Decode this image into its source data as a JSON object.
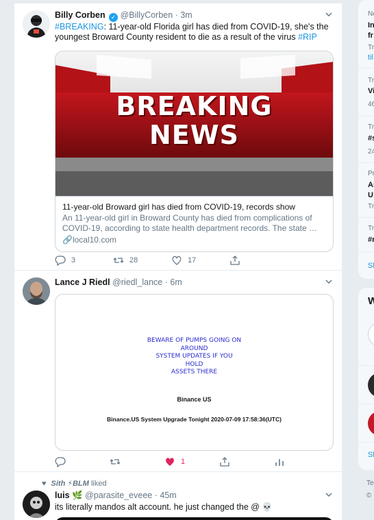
{
  "tweets": [
    {
      "name": "Billy Corben",
      "handle": "@BillyCorben",
      "time": "3m",
      "text_tag1": "#BREAKING",
      "text_body": ": 11-year-old Florida girl has died from COVID-19, she's the youngest Broward County resident to die as a result of the virus ",
      "text_tag2": "#RIP",
      "image_headline_1": "BREAKING",
      "image_headline_2": "NEWS",
      "card_title": "11-year-old Broward girl has died from COVID-19, records show",
      "card_desc": "An 11-year-old girl in Broward County has died from complications of COVID-19, according to state health department records. The state …",
      "card_link": "local10.com",
      "replies": "3",
      "retweets": "28",
      "likes": "17"
    },
    {
      "name": "Lance J Riedl",
      "handle": "@riedl_lance",
      "time": "6m",
      "promo_line1": "BEWARE OF PUMPS GOING ON",
      "promo_line2": "AROUND",
      "promo_line3": "SYSTEM UPDATES IF YOU",
      "promo_line4": "HOLD",
      "promo_line5": "ASSETS THERE",
      "promo_brand": "Binance US",
      "promo_footer": "Binance.US System Upgrade Tonight 2020-07-09 17:58:36(UTC)",
      "replies": "",
      "retweets": "",
      "likes": "1"
    },
    {
      "liked_by": "Sith ⚡BLM",
      "liked_label": "liked",
      "name": "luis 🌿",
      "handle": "@parasite_eveee",
      "time": "45m",
      "text": "its literally mandos alt account. he just changed the @ 💀"
    }
  ],
  "sidebar": {
    "trends": [
      {
        "small": "Ne",
        "bold1": "In",
        "bold2": "fr",
        "meta1": "Tr",
        "link": "til"
      },
      {
        "small": "Tr",
        "bold1": "Vi",
        "meta1": "46"
      },
      {
        "small": "Tr",
        "bold1": "#s",
        "meta1": "24"
      },
      {
        "small": "Pr",
        "bold1": "As",
        "bold2": "U",
        "meta1": "Tr"
      },
      {
        "small": "Tr",
        "bold1": "#n"
      }
    ],
    "show_more": "Sh",
    "who_to_follow_title": "W",
    "show_more_2": "Sh",
    "footer_1": "Te",
    "footer_2": "©"
  },
  "colors": {
    "accent": "#1da1f2",
    "link": "#1b95e0",
    "like": "#e0245e",
    "muted": "#657786"
  }
}
